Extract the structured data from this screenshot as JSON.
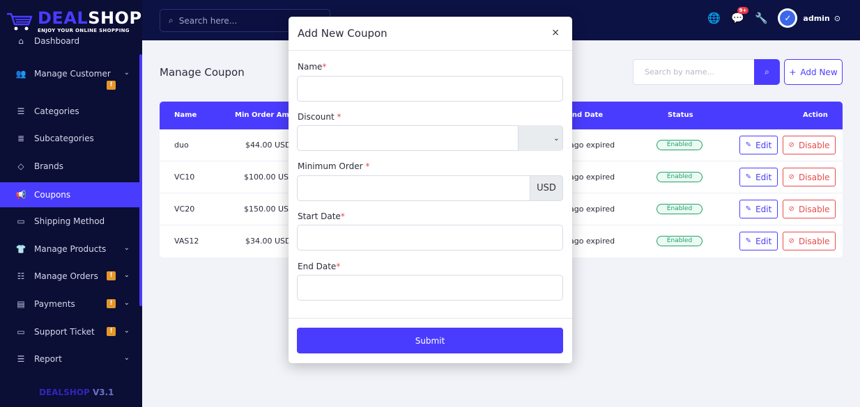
{
  "brand": {
    "deal": "DEAL",
    "shop": "SHOP",
    "tagline": "ENJOY YOUR ONLINE SHOPPING",
    "version_name": "DEALSHOP",
    "version_num": "V3.1"
  },
  "sidebar": {
    "items": [
      {
        "label": "Dashboard",
        "icon": "home-icon",
        "active": false
      },
      {
        "label": "Manage Customer",
        "icon": "users-icon",
        "active": false,
        "chevron": true,
        "warning": true
      },
      {
        "label": "Categories",
        "icon": "list-icon",
        "active": false
      },
      {
        "label": "Subcategories",
        "icon": "sublist-icon",
        "active": false
      },
      {
        "label": "Brands",
        "icon": "tag-icon",
        "active": false
      },
      {
        "label": "Coupons",
        "icon": "megaphone-icon",
        "active": true
      },
      {
        "label": "Shipping Method",
        "icon": "truck-icon",
        "active": false
      },
      {
        "label": "Manage Products",
        "icon": "shirt-icon",
        "active": false,
        "chevron": true
      },
      {
        "label": "Manage Orders",
        "icon": "orders-icon",
        "active": false,
        "chevron": true,
        "warning": true
      },
      {
        "label": "Payments",
        "icon": "payment-icon",
        "active": false,
        "chevron": true,
        "warning": true
      },
      {
        "label": "Support Ticket",
        "icon": "ticket-icon",
        "active": false,
        "chevron": true,
        "warning": true
      },
      {
        "label": "Report",
        "icon": "report-icon",
        "active": false,
        "chevron": true
      }
    ],
    "warning_mark": "!"
  },
  "topbar": {
    "search_placeholder": "Search here...",
    "notification_badge": "9+",
    "user_name": "admin"
  },
  "page": {
    "title": "Manage Coupon",
    "search_placeholder": "Search by name...",
    "add_new_label": "Add New"
  },
  "table": {
    "headers": {
      "name": "Name",
      "min_order": "Min Order Amount",
      "end_date": "End Date",
      "status": "Status",
      "action": "Action"
    },
    "rows": [
      {
        "name": "duo",
        "min_order": "$44.00 USD",
        "end_date": "ago expired",
        "status": "Enabled"
      },
      {
        "name": "VC10",
        "min_order": "$100.00 USD",
        "end_date": "ago expired",
        "status": "Enabled"
      },
      {
        "name": "VC20",
        "min_order": "$150.00 USD",
        "end_date": "ago expired",
        "status": "Enabled"
      },
      {
        "name": "VAS12",
        "min_order": "$34.00 USD",
        "end_date": "ago expired",
        "status": "Enabled"
      }
    ],
    "edit_label": "Edit",
    "disable_label": "Disable"
  },
  "modal": {
    "title": "Add New Coupon",
    "close": "×",
    "fields": {
      "name_label": "Name",
      "discount_label": "Discount",
      "min_order_label": "Minimum Order",
      "start_date_label": "Start Date",
      "end_date_label": "End Date",
      "required_mark": "*",
      "currency_addon": "USD",
      "discount_select_value": ""
    },
    "submit_label": "Submit"
  }
}
